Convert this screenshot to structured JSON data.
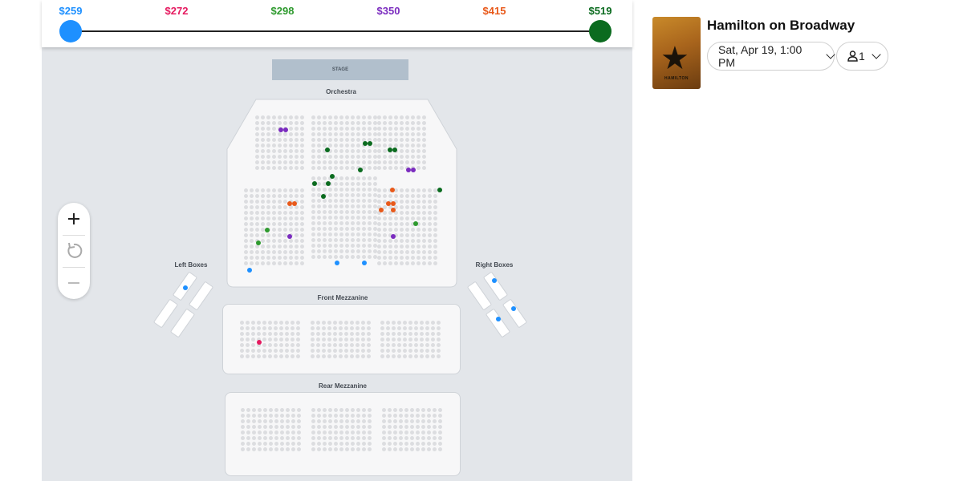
{
  "price_slider": {
    "prices": [
      {
        "label": "$259",
        "color": "#1e90ff"
      },
      {
        "label": "$272",
        "color": "#e5195f"
      },
      {
        "label": "$298",
        "color": "#2e9a2e"
      },
      {
        "label": "$350",
        "color": "#7b2cbf"
      },
      {
        "label": "$415",
        "color": "#e8591a"
      },
      {
        "label": "$519",
        "color": "#0b6b1f"
      }
    ],
    "min_handle_color": "#1e90ff",
    "max_handle_color": "#0b6b1f"
  },
  "map": {
    "stage_label": "STAGE",
    "sections": {
      "orchestra": "Orchestra",
      "left_boxes": "Left Boxes",
      "right_boxes": "Right Boxes",
      "front_mezzanine": "Front Mezzanine",
      "rear_mezzanine": "Rear Mezzanine"
    },
    "zoom_controls": {
      "zoom_in_icon": "plus-icon",
      "reset_icon": "reset-icon",
      "zoom_out_icon": "minus-icon"
    }
  },
  "event": {
    "title": "Hamilton on Broadway",
    "poster_text": "HAMILTON",
    "date_select": "Sat, Apr 19, 1:00 PM",
    "quantity_select": "1"
  }
}
